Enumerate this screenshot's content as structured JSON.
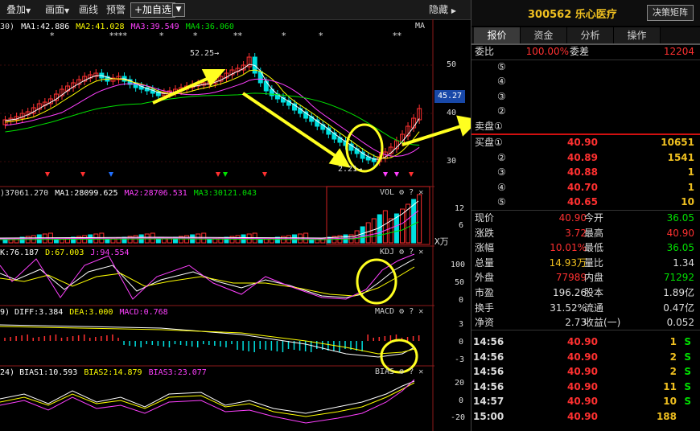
{
  "toolbar": {
    "overlay": "叠加",
    "canvas": "画面",
    "draw": "画线",
    "warn": "预警",
    "add": "+加自选",
    "arrow": "▼",
    "hide": "隐藏"
  },
  "price_hdr": {
    "ma0": "30)",
    "ma1": "MA1:42.886",
    "ma2": "MA2:41.028",
    "ma3": "MA3:39.549",
    "ma4": "MA4:36.060",
    "ma_tag": "MA"
  },
  "price_axis": {
    "t50": "50",
    "t40": "40",
    "t30": "30",
    "current": "45.27",
    "high": "52.25→",
    "low": "2.21→"
  },
  "vol_hdr": {
    "v0": ")37061.270",
    "ma1": "MA1:28099.625",
    "ma2": "MA2:28706.531",
    "ma3": "MA3:30121.043",
    "tag": "VOL",
    "unit": "X万",
    "t12": "12",
    "t6": "6"
  },
  "kdj_hdr": {
    "k": "K:76.187",
    "d": "D:67.003",
    "j": "J:94.554",
    "tag": "KDJ",
    "t100": "100",
    "t50": "50",
    "t0": "0"
  },
  "macd_hdr": {
    "diff": "9) DIFF:3.384",
    "dea": "DEA:3.000",
    "macd": "MACD:0.768",
    "tag": "MACD",
    "t3": "3",
    "t0": "0",
    "tm3": "-3"
  },
  "bias_hdr": {
    "b1": "24) BIAS1:10.593",
    "b2": "BIAS2:14.879",
    "b3": "BIAS3:23.077",
    "tag": "BIAS",
    "t20": "20",
    "t0": "0",
    "tm20": "-20"
  },
  "colors": {
    "up": "#ff3030",
    "down": "#00e0e0",
    "ma1": "#ffffff",
    "ma2": "#ffff00",
    "ma3": "#ff40ff",
    "ma4": "#00e000",
    "arrow": "#ffff20"
  },
  "stock": {
    "code": "300562",
    "name": "乐心医疗",
    "title": "300562 乐心医疗",
    "btn": "决策矩阵"
  },
  "tabs": [
    "报价",
    "资金",
    "分析",
    "操作"
  ],
  "book": {
    "wb_label": "委比",
    "wb_val": "100.00%",
    "wc_label": "委差",
    "wc_val": "12204",
    "sells": [
      {
        "label": "⑤",
        "price": "",
        "vol": ""
      },
      {
        "label": "④",
        "price": "",
        "vol": ""
      },
      {
        "label": "③",
        "price": "",
        "vol": ""
      },
      {
        "label": "②",
        "price": "",
        "vol": ""
      },
      {
        "label": "卖盘①",
        "price": "",
        "vol": ""
      }
    ],
    "buys": [
      {
        "label": "买盘①",
        "price": "40.90",
        "vol": "10651"
      },
      {
        "label": "②",
        "price": "40.89",
        "vol": "1541"
      },
      {
        "label": "③",
        "price": "40.88",
        "vol": "1"
      },
      {
        "label": "④",
        "price": "40.70",
        "vol": "1"
      },
      {
        "label": "⑤",
        "price": "40.65",
        "vol": "10"
      }
    ]
  },
  "quote": [
    {
      "l1": "现价",
      "v1": "40.90",
      "l2": "今开",
      "v2": "36.05",
      "c1": "#ff3030",
      "c2": "#00e000"
    },
    {
      "l1": "涨跌",
      "v1": "3.72",
      "l2": "最高",
      "v2": "40.90",
      "c1": "#ff3030",
      "c2": "#ff3030"
    },
    {
      "l1": "涨幅",
      "v1": "10.01%",
      "l2": "最低",
      "v2": "36.05",
      "c1": "#ff3030",
      "c2": "#00e000"
    },
    {
      "l1": "总量",
      "v1": "14.93万",
      "l2": "量比",
      "v2": "1.34",
      "c1": "#f0c020",
      "c2": "#ddd"
    },
    {
      "l1": "外盘",
      "v1": "77989",
      "l2": "内盘",
      "v2": "71292",
      "c1": "#ff3030",
      "c2": "#00e000"
    },
    {
      "l1": "市盈",
      "v1": "196.26",
      "l2": "股本",
      "v2": "1.89亿",
      "c1": "#ddd",
      "c2": "#ddd"
    },
    {
      "l1": "换手",
      "v1": "31.52%",
      "l2": "流通",
      "v2": "0.47亿",
      "c1": "#ddd",
      "c2": "#ddd"
    },
    {
      "l1": "净资",
      "v1": "2.73",
      "l2": "收益(一)",
      "v2": "0.052",
      "c1": "#ddd",
      "c2": "#ddd"
    }
  ],
  "ticks": [
    {
      "time": "14:56",
      "price": "40.90",
      "vol": "1",
      "side": "S"
    },
    {
      "time": "14:56",
      "price": "40.90",
      "vol": "2",
      "side": "S"
    },
    {
      "time": "14:56",
      "price": "40.90",
      "vol": "2",
      "side": "S"
    },
    {
      "time": "14:56",
      "price": "40.90",
      "vol": "11",
      "side": "S"
    },
    {
      "time": "14:57",
      "price": "40.90",
      "vol": "10",
      "side": "S"
    },
    {
      "time": "15:00",
      "price": "40.90",
      "vol": "188",
      "side": ""
    }
  ]
}
